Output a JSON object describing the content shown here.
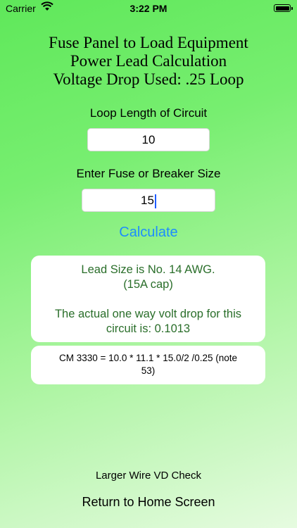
{
  "status_bar": {
    "carrier": "Carrier",
    "time": "3:22 PM"
  },
  "title": {
    "line1": "Fuse Panel to Load Equipment",
    "line2": "Power Lead Calculation",
    "line3": "Voltage Drop Used: .25 Loop"
  },
  "loop_length": {
    "label": "Loop Length of Circuit",
    "value": "10"
  },
  "fuse_size": {
    "label": "Enter Fuse or Breaker Size",
    "value": "15"
  },
  "calculate_label": "Calculate",
  "result": {
    "line1": "Lead Size is No. 14 AWG.",
    "line2": "(15A cap)",
    "line3": "The actual one way volt drop for this",
    "line4": "circuit is: 0.1013"
  },
  "formula": {
    "line1": "CM 3330 = 10.0 * 11.1 * 15.0/2 /0.25 (note",
    "line2": "53)"
  },
  "links": {
    "larger_wire": "Larger Wire VD Check",
    "return_home": "Return to Home Screen"
  },
  "colors": {
    "accent": "#1c8cff",
    "result_text": "#2a6e2a",
    "background_top": "#5fe85a",
    "background_bottom": "#e6fbe0"
  }
}
